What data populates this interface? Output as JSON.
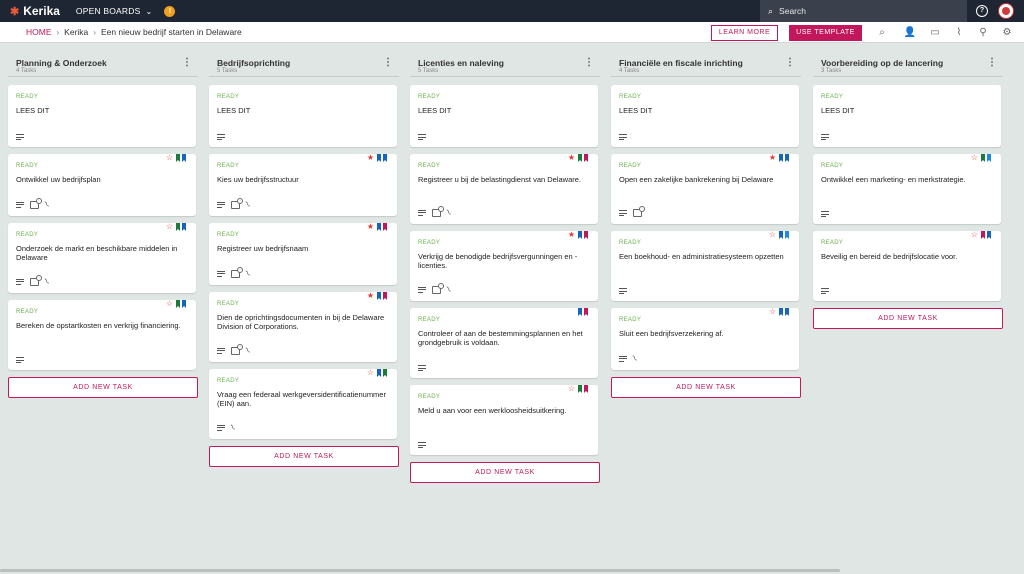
{
  "app": {
    "logo": "Kerika",
    "open_boards": "OPEN BOARDS",
    "org_badge": "!",
    "search_placeholder": "Search",
    "help": "?"
  },
  "breadcrumb": {
    "home": "HOME",
    "org": "Kerika",
    "board": "Een nieuw bedrijf starten in Delaware"
  },
  "actions": {
    "learn_more": "LEARN MORE",
    "use_template": "USE TEMPLATE"
  },
  "colors": {
    "accent": "#c2185b",
    "ready": "#6ab04c",
    "topbar": "#1f2633"
  },
  "columns": [
    {
      "title": "Planning & Onderzoek",
      "count": "4 Tasks",
      "add": "ADD NEW TASK",
      "cards": [
        {
          "status": "READY",
          "title": "LEES DIT",
          "icons": [
            "lines"
          ],
          "flags": []
        },
        {
          "status": "READY",
          "title": "Ontwikkel uw bedrijfsplan",
          "icons": [
            "lines",
            "checklist",
            "attachment"
          ],
          "flags": [
            "star-outline",
            "#1e7a3a",
            "#1565c0"
          ]
        },
        {
          "status": "READY",
          "title": "Onderzoek de markt en beschikbare middelen in Delaware",
          "icons": [
            "lines",
            "checklist",
            "attachment"
          ],
          "flags": [
            "star-outline",
            "#1e7a3a",
            "#1565c0"
          ]
        },
        {
          "status": "READY",
          "title": "Bereken de opstartkosten en verkrijg financiering.",
          "icons": [
            "lines"
          ],
          "flags": [
            "star-outline",
            "#1e7a3a",
            "#1565c0"
          ]
        }
      ]
    },
    {
      "title": "Bedrijfsoprichting",
      "count": "5 Tasks",
      "add": "ADD NEW TASK",
      "cards": [
        {
          "status": "READY",
          "title": "LEES DIT",
          "icons": [
            "lines"
          ],
          "flags": []
        },
        {
          "status": "READY",
          "title": "Kies uw bedrijfsstructuur",
          "icons": [
            "lines",
            "checklist",
            "attachment"
          ],
          "flags": [
            "star-red",
            "#1565c0",
            "#1565c0"
          ]
        },
        {
          "status": "READY",
          "title": "Registreer uw bedrijfsnaam",
          "icons": [
            "lines",
            "checklist",
            "attachment"
          ],
          "flags": [
            "star-red",
            "#1565c0",
            "#c2185b"
          ]
        },
        {
          "status": "READY",
          "title": "Dien de oprichtingsdocumenten in bij de Delaware Division of Corporations.",
          "icons": [
            "lines",
            "checklist",
            "attachment"
          ],
          "flags": [
            "star-red",
            "#1565c0",
            "#c2185b"
          ]
        },
        {
          "status": "READY",
          "title": "Vraag een federaal werkgeversidentificatienummer (EIN) aan.",
          "icons": [
            "lines",
            "attachment"
          ],
          "flags": [
            "star-outline",
            "#1565c0",
            "#1e7a3a"
          ]
        }
      ]
    },
    {
      "title": "Licenties en naleving",
      "count": "5 Tasks",
      "add": "ADD NEW TASK",
      "cards": [
        {
          "status": "READY",
          "title": "LEES DIT",
          "icons": [
            "lines"
          ],
          "flags": []
        },
        {
          "status": "READY",
          "title": "Registreer u bij de belastingdienst van Delaware.",
          "icons": [
            "lines",
            "checklist",
            "attachment"
          ],
          "flags": [
            "star-red",
            "#1e7a3a",
            "#c2185b"
          ]
        },
        {
          "status": "READY",
          "title": "Verkrijg de benodigde bedrijfsvergunningen en -licenties.",
          "icons": [
            "lines",
            "checklist",
            "attachment"
          ],
          "flags": [
            "star-red",
            "#1565c0",
            "#c2185b"
          ]
        },
        {
          "status": "READY",
          "title": "Controleer of aan de bestemmingsplannen en het grondgebruik is voldaan.",
          "icons": [
            "lines"
          ],
          "flags": [
            "#1565c0",
            "#c2185b"
          ]
        },
        {
          "status": "READY",
          "title": "Meld u aan voor een werkloosheidsuitkering.",
          "icons": [
            "lines"
          ],
          "flags": [
            "star-outline",
            "#1e7a3a",
            "#c2185b"
          ]
        }
      ]
    },
    {
      "title": "Financiële en fiscale inrichting",
      "count": "4 Tasks",
      "add": "ADD NEW TASK",
      "cards": [
        {
          "status": "READY",
          "title": "LEES DIT",
          "icons": [
            "lines"
          ],
          "flags": []
        },
        {
          "status": "READY",
          "title": "Open een zakelijke bankrekening bij Delaware",
          "icons": [
            "lines",
            "checklist"
          ],
          "flags": [
            "star-red",
            "#1565c0",
            "#1565c0"
          ]
        },
        {
          "status": "READY",
          "title": "Een boekhoud- en administratiesysteem opzetten",
          "icons": [
            "lines"
          ],
          "flags": [
            "star-outline",
            "#1565c0",
            "#1e88e5"
          ]
        },
        {
          "status": "READY",
          "title": "Sluit een bedrijfsverzekering af.",
          "icons": [
            "lines",
            "attachment"
          ],
          "flags": [
            "star-outline",
            "#1565c0",
            "#1565c0"
          ]
        }
      ]
    },
    {
      "title": "Voorbereiding op de lancering",
      "count": "3 Tasks",
      "add": "ADD NEW TASK",
      "cards": [
        {
          "status": "READY",
          "title": "LEES DIT",
          "icons": [
            "lines"
          ],
          "flags": []
        },
        {
          "status": "READY",
          "title": "Ontwikkel een marketing- en merkstrategie.",
          "icons": [
            "lines"
          ],
          "flags": [
            "star-outline",
            "#1e7a3a",
            "#1e88e5"
          ]
        },
        {
          "status": "READY",
          "title": "Beveilig en bereid de bedrijfslocatie voor.",
          "icons": [
            "lines"
          ],
          "flags": [
            "star-outline",
            "#c2185b",
            "#1565c0"
          ]
        }
      ]
    }
  ]
}
